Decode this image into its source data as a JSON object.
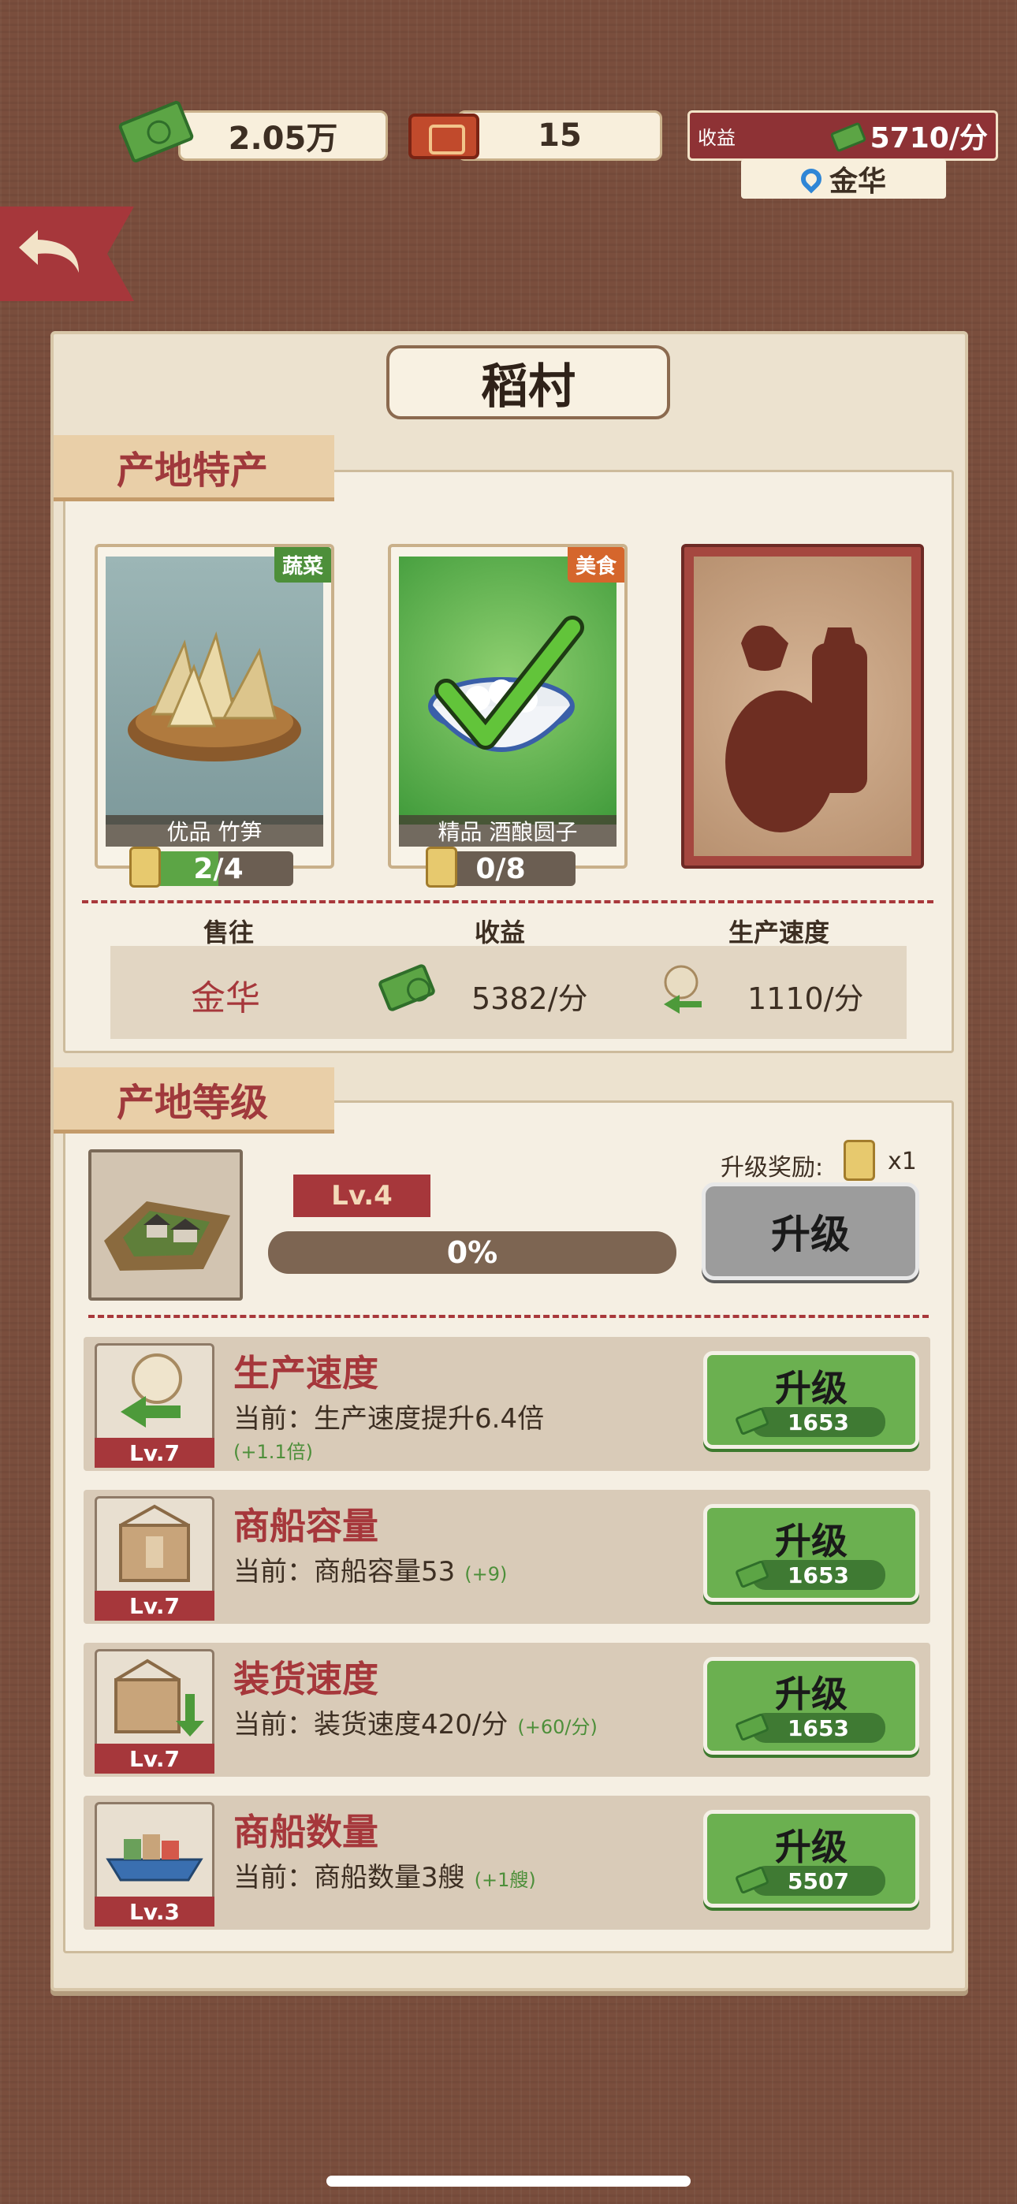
{
  "header": {
    "cash": "2.05万",
    "tickets": "15",
    "income_label": "收益",
    "income_value": "5710/分",
    "location": "金华"
  },
  "panel": {
    "title": "稻村",
    "specialty_section": "产地特产",
    "products": [
      {
        "name": "优品 竹笋",
        "tag": "蔬菜",
        "tag_color": "#4d8f3a",
        "progress": "2/4",
        "progress_fraction": 0.5
      },
      {
        "name": "精品 酒酿圆子",
        "tag": "美食",
        "tag_color": "#d5662c",
        "progress": "0/8",
        "progress_fraction": 0
      },
      {
        "name": "",
        "tag": "",
        "locked": true
      }
    ],
    "stats": {
      "sell_to_label": "售往",
      "income_label": "收益",
      "speed_label": "生产速度",
      "sell_to_value": "金华",
      "income_value": "5382/分",
      "speed_value": "1110/分"
    },
    "level_section": "产地等级",
    "level": {
      "lv": "Lv.4",
      "progress_text": "0%",
      "reward_label": "升级奖励:",
      "reward_count": "x1",
      "upgrade_label": "升级"
    },
    "upgrades": [
      {
        "title": "生产速度",
        "lv": "Lv.7",
        "current": "当前：生产速度提升6.4倍",
        "bonus": "(+1.1倍)",
        "button": "升级",
        "cost": "1653",
        "icon": "production-speed-icon"
      },
      {
        "title": "商船容量",
        "lv": "Lv.7",
        "current": "当前：商船容量53",
        "bonus": "(+9)",
        "button": "升级",
        "cost": "1653",
        "icon": "cargo-box-icon"
      },
      {
        "title": "装货速度",
        "lv": "Lv.7",
        "current": "当前：装货速度420/分",
        "bonus": "(+60/分)",
        "button": "升级",
        "cost": "1653",
        "icon": "loading-speed-icon"
      },
      {
        "title": "商船数量",
        "lv": "Lv.3",
        "current": "当前：商船数量3艘",
        "bonus": "(+1艘)",
        "button": "升级",
        "cost": "5507",
        "icon": "ship-icon"
      }
    ]
  }
}
